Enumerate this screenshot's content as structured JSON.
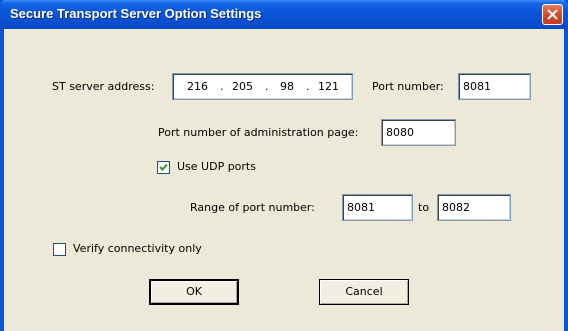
{
  "window": {
    "title": "Secure Transport Server Option Settings"
  },
  "server": {
    "address_label": "ST server address:",
    "address_octets": [
      "216",
      "205",
      "98",
      "121"
    ],
    "port_label": "Port number:",
    "port_value": "8081"
  },
  "admin": {
    "port_label": "Port number of administration page:",
    "port_value": "8080"
  },
  "udp": {
    "checkbox_label": "Use UDP ports",
    "checked": true,
    "range_label": "Range of port number:",
    "range_from": "8081",
    "to_label": "to",
    "range_to": "8082"
  },
  "verify": {
    "checkbox_label": "Verify connectivity only",
    "checked": false
  },
  "buttons": {
    "ok": "OK",
    "cancel": "Cancel"
  },
  "colors": {
    "title_bar": "#0a55d7",
    "dialog_bg": "#ece9d8",
    "close_button": "#d9492b"
  }
}
